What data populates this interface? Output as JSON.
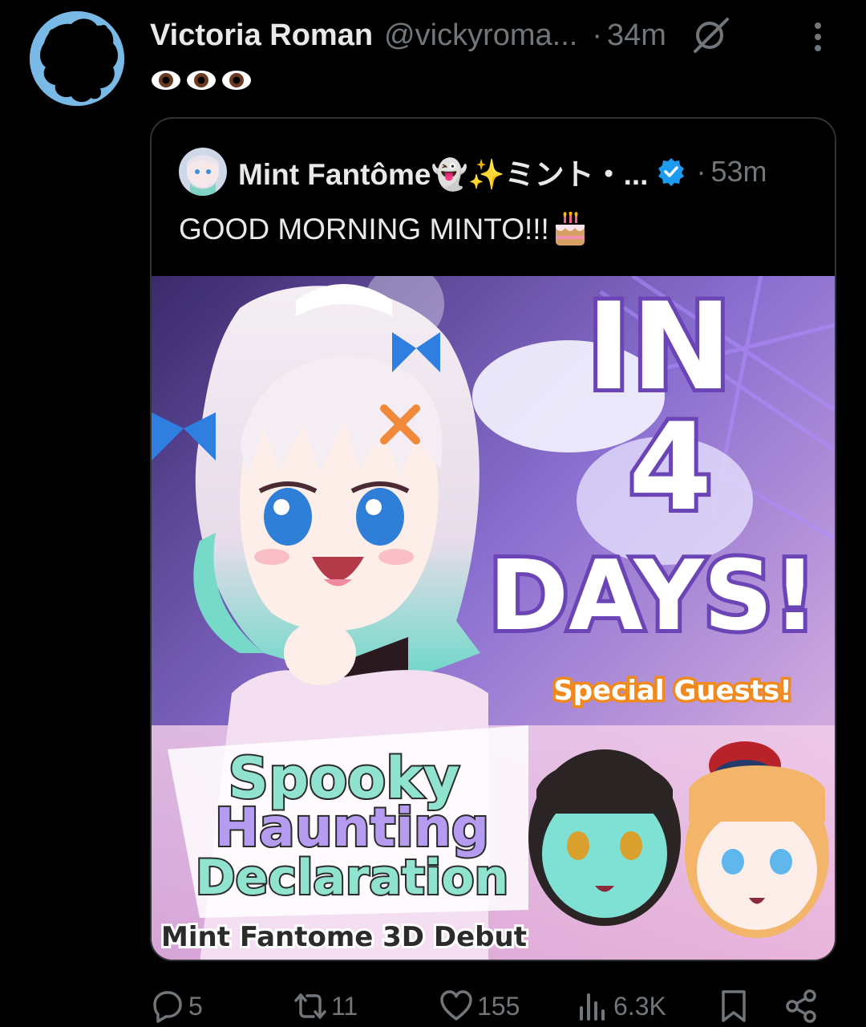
{
  "tweet": {
    "author_name": "Victoria Roman",
    "author_handle": "@vickyroma...",
    "separator": "·",
    "timestamp": "34m",
    "text_emoji": [
      "eyes",
      "eyes",
      "eyes"
    ]
  },
  "quote": {
    "author_name": "Mint Fantôme👻✨ミント・...",
    "separator": "·",
    "timestamp": "53m",
    "text": "GOOD MORNING MINTO!!!",
    "text_emoji": "birthday-cake",
    "image": {
      "headline_line1": "IN",
      "headline_line2": "4",
      "headline_line3": "DAYS!",
      "badge": "Special Guests!",
      "logo_line1": "Spooky",
      "logo_line2": "Haunting",
      "logo_line3": "Declaration",
      "logo_subtitle": "Mint Fantome 3D Debut"
    }
  },
  "actions": {
    "replies": "5",
    "reposts": "11",
    "likes": "155",
    "views": "6.3K"
  },
  "colors": {
    "background": "#000000",
    "primary_text": "#e7e9ea",
    "secondary_text": "#71767b",
    "border": "#2f3336",
    "verified": "#1d9bf0",
    "headline_outline": "#6b45b5",
    "badge_outline": "#f08a1e"
  }
}
